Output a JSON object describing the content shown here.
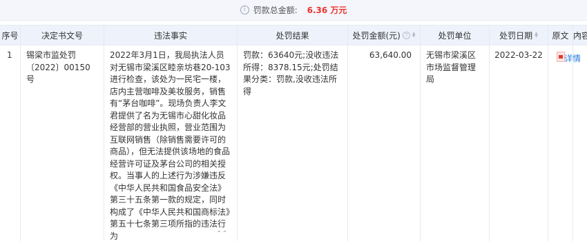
{
  "summary": {
    "label": "罚款总金额:",
    "value": "6.36 万元"
  },
  "header": {
    "index": "序号",
    "doc_no": "决定书文号",
    "facts": "违法事实",
    "result": "处罚结果",
    "amount": "处罚金额(元)",
    "unit": "处罚单位",
    "date": "处罚日期",
    "original": "原文",
    "content": "内容"
  },
  "rows": [
    {
      "index": "1",
      "doc_no": "锡梁市监处罚〔2022〕00150号",
      "facts": "2022年3月1日，我局执法人员对无锡市梁溪区睦亲坊巷20-103进行检查，该处为一民宅一楼，店内主营咖啡及美妆服务，销售有“茅台咖啡”。现场负责人李文君提供了名为无锡市心甜化妆品经营部的营业执照，营业范围为互联网销售（除销售需要许可的商品），但无法提供该场地的食品经营许可证及茅台公司的相关授权。当事人的上述行为涉嫌违反《中华人民共和国食品安全法》第三十五条第一款的规定，同时构成了《中华人民共和国商标法》第五十七条第三项所指的违法行为",
      "result": "罚款：63640元;没收违法所得：8378.15元;处罚结果分类：罚款,没收违法所得",
      "amount": "63,640.00",
      "unit": "无锡市梁溪区市场监督管理局",
      "date": "2022-03-22",
      "detail": "详情"
    }
  ],
  "icons": {
    "collapse": "⌃",
    "expand": "⌃⌃"
  },
  "colors": {
    "accent": "#e8342f",
    "link": "#2d7fe2",
    "header_bg": "#eef3fb",
    "summary_bg": "#f4f6fb"
  }
}
